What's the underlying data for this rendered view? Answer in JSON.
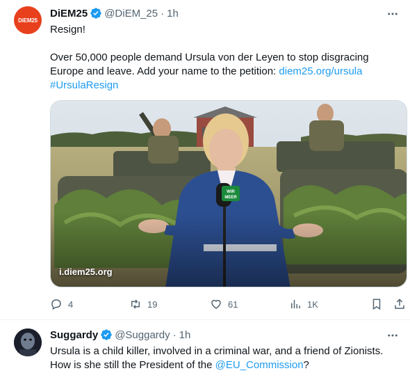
{
  "tweet1": {
    "avatar_text": "DiEM25",
    "name": "DiEM25",
    "handle": "@DiEM_25",
    "separator": "·",
    "time": "1h",
    "line1": "Resign!",
    "line2a": "Over 50,000 people demand Ursula von der Leyen to stop disgracing",
    "line2b": "Europe and leave. Add your name to the petition: ",
    "link": "diem25.org/ursula",
    "hashtag": "#UrsulaResign",
    "media_label": "i.diem25.org",
    "mic_text": "WIR\nMEER",
    "actions": {
      "replies": "4",
      "retweets": "19",
      "likes": "61",
      "views": "1K"
    }
  },
  "tweet2": {
    "name": "Suggardy",
    "handle": "@Suggardy",
    "separator": "·",
    "time": "1h",
    "line1": "Ursula is a child killer, involved in a criminal war, and a friend of Zionists.",
    "line2a": "How is she still the President of the ",
    "mention": "@EU_Commission",
    "line2b": "?"
  },
  "colors": {
    "accent": "#1d9bf0",
    "text": "#0f1419",
    "muted": "#536471",
    "diem_brand": "#e8401c"
  },
  "icons": [
    "verified-badge-icon",
    "more-options-icon",
    "reply-icon",
    "retweet-icon",
    "like-icon",
    "views-icon",
    "bookmark-icon",
    "share-icon"
  ]
}
